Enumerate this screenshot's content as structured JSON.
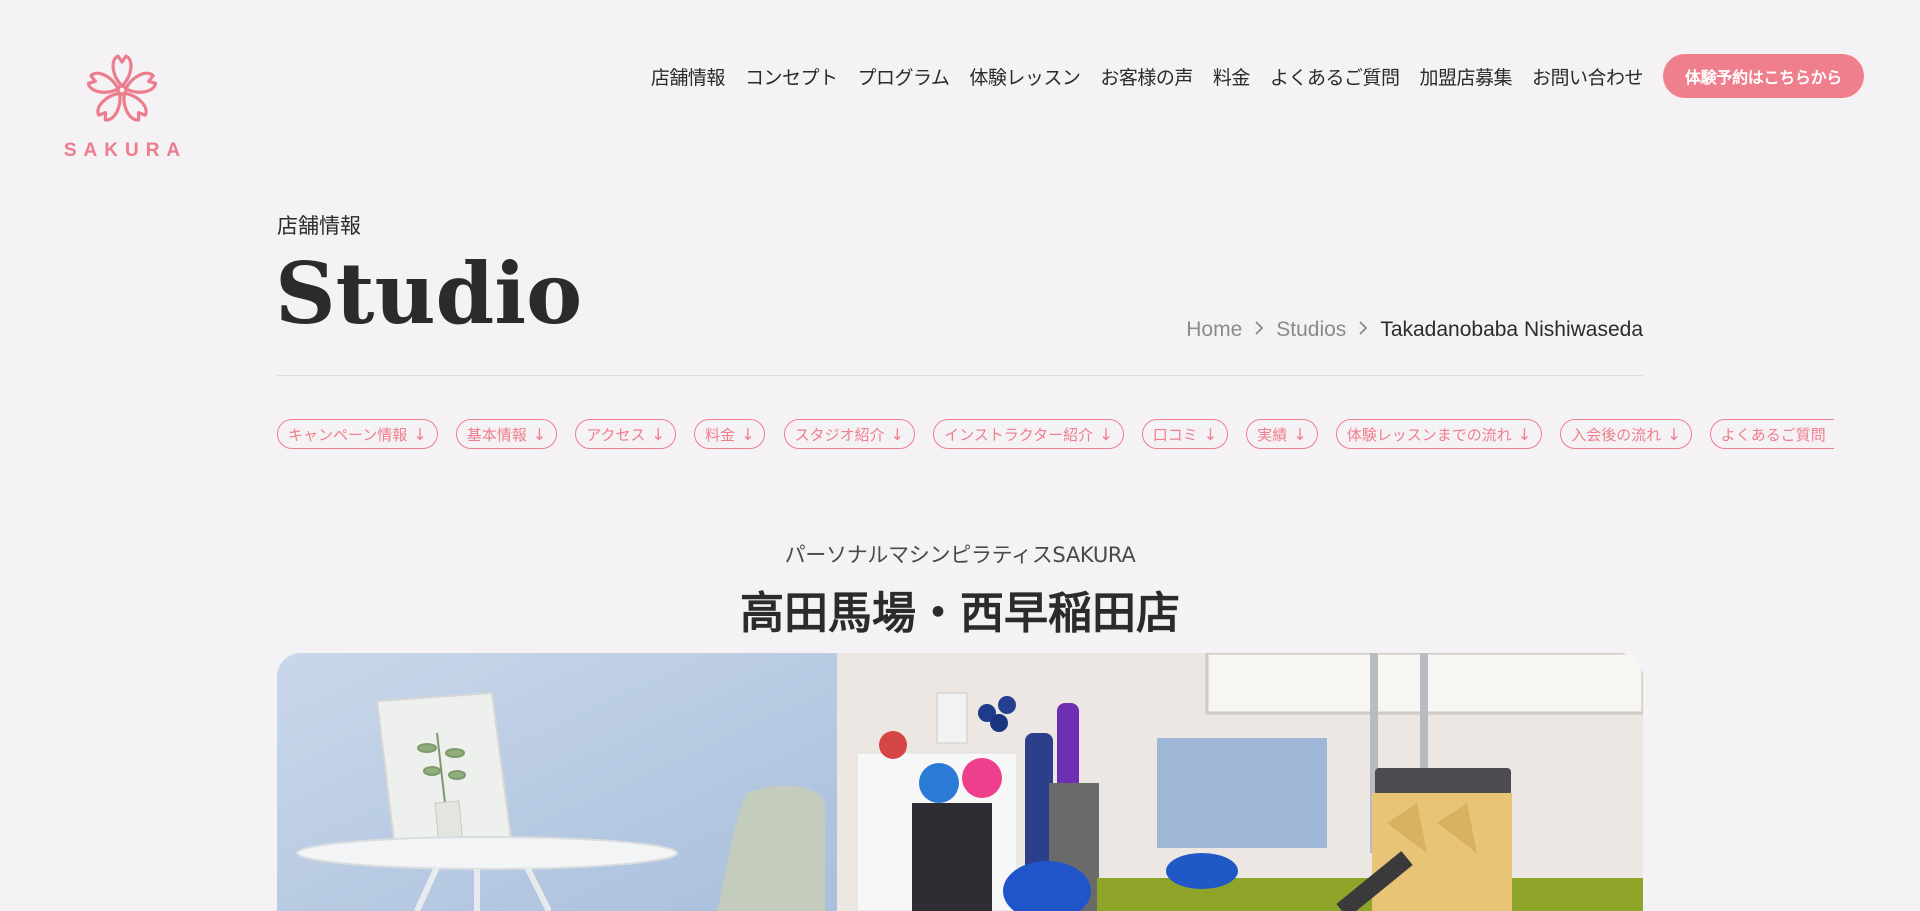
{
  "logo": {
    "text": "SAKURA",
    "color": "#ec7d8c",
    "icon": "sakura-flower-icon"
  },
  "nav": {
    "items": [
      "店舗情報",
      "コンセプト",
      "プログラム",
      "体験レッスン",
      "お客様の声",
      "料金",
      "よくあるご質問",
      "加盟店募集",
      "お問い合わせ"
    ],
    "cta": "体験予約はこちらから"
  },
  "page": {
    "eyebrow": "店舗情報",
    "title": "Studio"
  },
  "breadcrumb": {
    "home": "Home",
    "studios": "Studios",
    "current": "Takadanobaba Nishiwaseda",
    "separator_icon": "chevron-right-icon"
  },
  "anchors": [
    "キャンペーン情報",
    "基本情報",
    "アクセス",
    "料金",
    "スタジオ紹介",
    "インストラクター紹介",
    "口コミ",
    "実績",
    "体験レッスンまでの流れ",
    "入会後の流れ",
    "よくあるご質問"
  ],
  "studio": {
    "subtitle": "パーソナルマシンピラティスSAKURA",
    "name": "高田馬場・西早稲田店"
  },
  "colors": {
    "accent": "#ef7f8d",
    "background": "#f4f2f5",
    "text": "#2b2b2b"
  }
}
